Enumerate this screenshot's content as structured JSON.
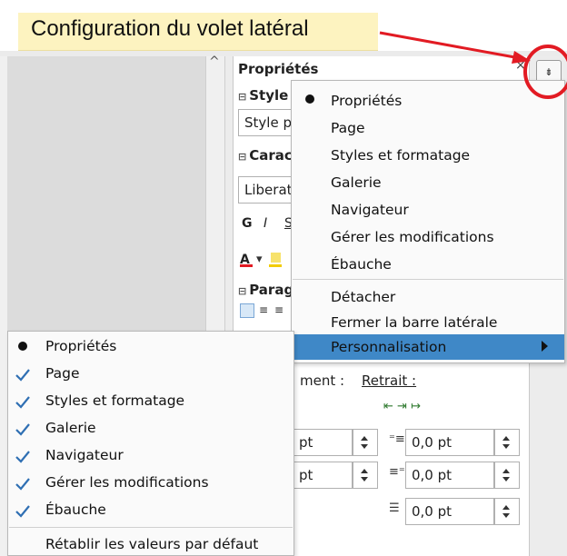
{
  "callout": {
    "text": "Configuration du volet latéral"
  },
  "sidebar": {
    "title": "Propriétés",
    "close_glyph": "×",
    "menu_glyph": "⇟",
    "sections": {
      "style": {
        "title": "Style",
        "value": "Style pa"
      },
      "character": {
        "title": "Carac",
        "font": "Liberat",
        "bold": "G",
        "italic": "I",
        "strike": "S"
      },
      "paragraph": {
        "title": "Parag"
      },
      "spacing": {
        "label": "ment :"
      },
      "indent": {
        "label": "Retrait :",
        "values": [
          "0,0 pt",
          "0,0 pt",
          "0,0 pt"
        ],
        "left_values": [
          "pt",
          "pt"
        ]
      }
    }
  },
  "menu": {
    "items": [
      {
        "label": "Propriétés",
        "bullet": true
      },
      {
        "label": "Page"
      },
      {
        "label": "Styles et formatage"
      },
      {
        "label": "Galerie"
      },
      {
        "label": "Navigateur"
      },
      {
        "label": "Gérer les modifications"
      },
      {
        "label": "Ébauche"
      }
    ],
    "actions": [
      {
        "label": "Détacher"
      },
      {
        "label": "Fermer la barre latérale"
      }
    ],
    "customize": {
      "label": "Personnalisation"
    }
  },
  "submenu": {
    "items": [
      {
        "label": "Propriétés",
        "mark": "bullet"
      },
      {
        "label": "Page",
        "mark": "check"
      },
      {
        "label": "Styles et formatage",
        "mark": "check"
      },
      {
        "label": "Galerie",
        "mark": "check"
      },
      {
        "label": "Navigateur",
        "mark": "check"
      },
      {
        "label": "Gérer les modifications",
        "mark": "check"
      },
      {
        "label": "Ébauche",
        "mark": "check"
      }
    ],
    "reset": {
      "label": "Rétablir les valeurs par défaut"
    }
  },
  "colors": {
    "highlight": "#3f88c7",
    "annotation": "#e21b23",
    "callout_bg": "#fdf3c0"
  }
}
